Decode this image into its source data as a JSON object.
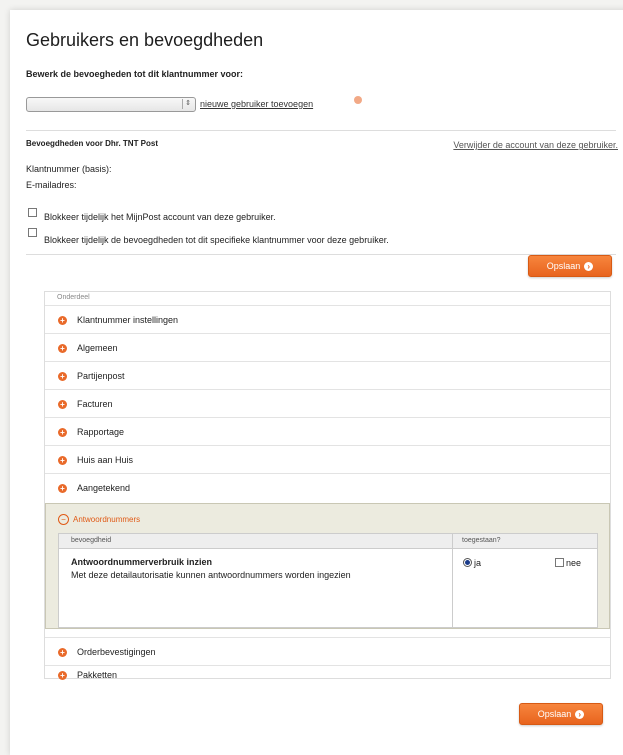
{
  "page": {
    "title": "Gebruikers en bevoegdheden"
  },
  "intro": {
    "text": "Bewerk de bevoegheden tot dit klantnummer voor:"
  },
  "user_select": {
    "value": "",
    "arrow_icon": "updown-arrows-icon"
  },
  "add_user": {
    "link": "nieuwe gebruiker toevoegen",
    "icon": "add-user-icon"
  },
  "account": {
    "permissions_for": "Bevoegdheden voor Dhr. TNT Post",
    "remove_link": "Verwijder de account van deze gebruiker.",
    "customer_number_label": "Klantnummer (basis):",
    "email_label": "E-mailadres:"
  },
  "blocks": [
    {
      "label": "Blokkeer tijdelijk het MijnPost account van deze gebruiker.",
      "checked": false
    },
    {
      "label": "Blokkeer tijdelijk de bevoegdheden tot dit specifieke klantnummer voor deze gebruiker.",
      "checked": false
    }
  ],
  "save_button": {
    "label": "Opslaan"
  },
  "section_header": "Onderdeel",
  "sections": [
    "Klantnummer instellingen",
    "Algemeen",
    "Partijenpost",
    "Facturen",
    "Rapportage",
    "Huis aan Huis",
    "Aangetekend"
  ],
  "expanded": {
    "title": "Antwoordnummers",
    "col_permission": "bevoegdheid",
    "col_allowed": "toegestaan?",
    "perm_title": "Antwoordnummerverbruik inzien",
    "perm_desc": "Met deze detailautorisatie kunnen antwoordnummers worden ingezien",
    "yes": "ja",
    "no": "nee",
    "selected": "ja"
  },
  "sections_after": [
    "Orderbevestigingen",
    "Pakketten"
  ],
  "colors": {
    "accent": "#e8641e"
  }
}
